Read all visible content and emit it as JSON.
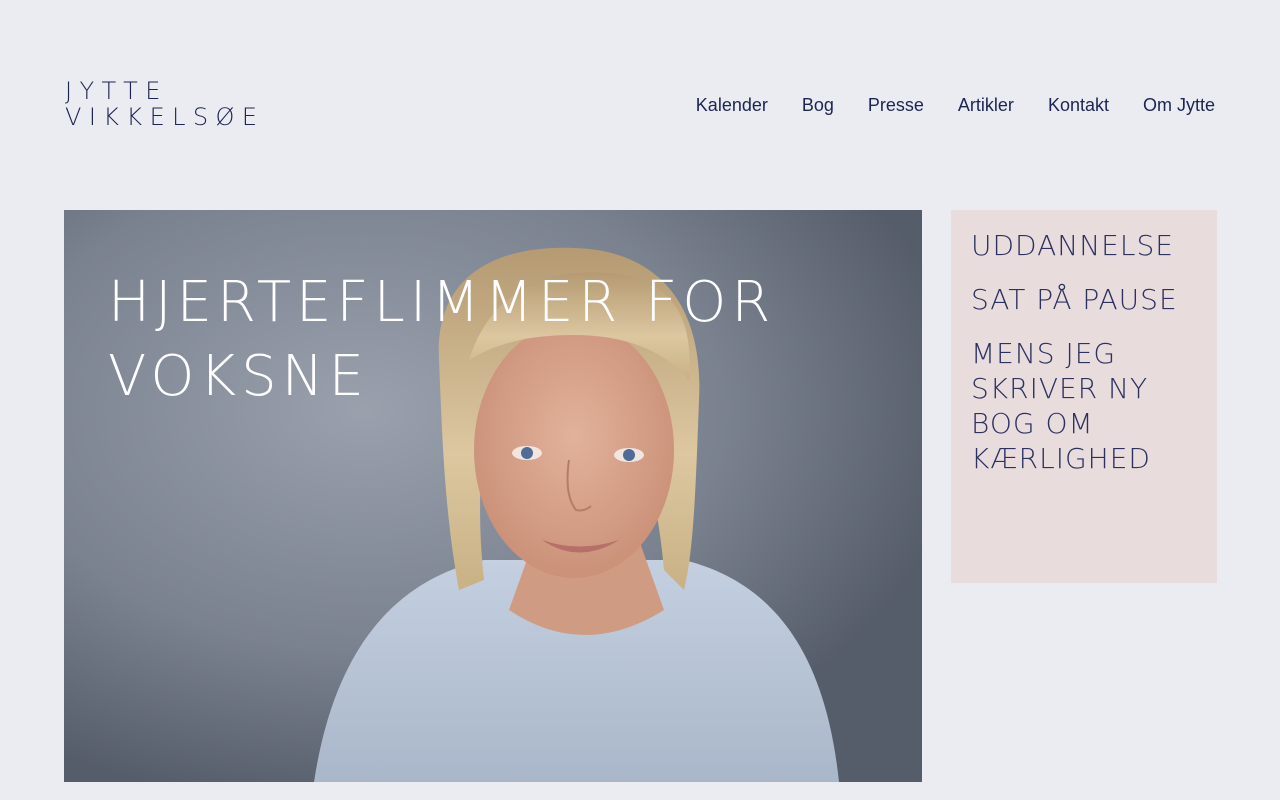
{
  "logo": {
    "line1": "JYTTE",
    "line2": "VIKKELSØE"
  },
  "nav": {
    "items": [
      {
        "label": "Kalender"
      },
      {
        "label": "Bog"
      },
      {
        "label": "Presse"
      },
      {
        "label": "Artikler"
      },
      {
        "label": "Kontakt"
      },
      {
        "label": "Om Jytte"
      }
    ]
  },
  "hero": {
    "title": "HJERTEFLIMMER FOR VOKSNE"
  },
  "sidebar": {
    "items": [
      {
        "label": "UDDANNELSE"
      },
      {
        "label": "SAT PÅ PAUSE"
      },
      {
        "label": "MENS JEG SKRIVER NY BOG OM KÆRLIGHED"
      }
    ]
  },
  "colors": {
    "background": "#ebecf1",
    "text": "#1b2552",
    "sidebar_bg": "#e8dcdc",
    "hero_title": "#ffffff"
  }
}
